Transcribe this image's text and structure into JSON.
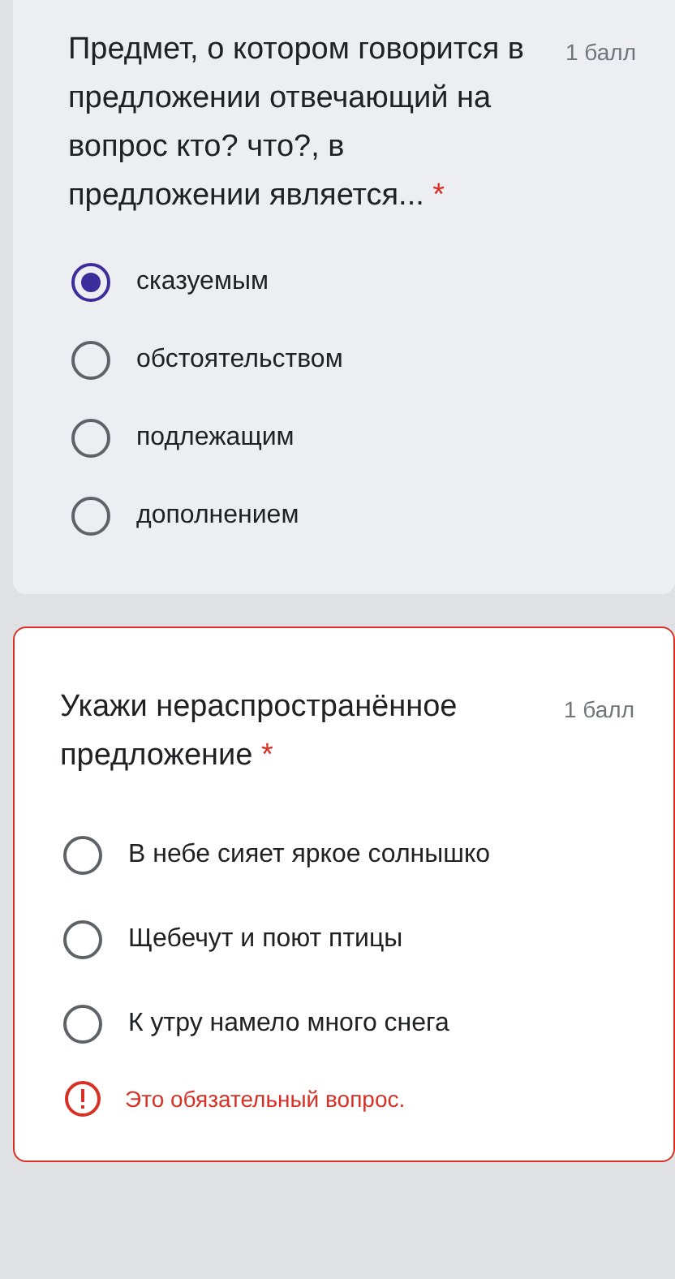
{
  "questions": [
    {
      "title": "Предмет, о котором говорится в предложении отвечающий на вопрос кто? что?, в предложении является...",
      "required_mark": "*",
      "points": "1 балл",
      "error": false,
      "options": [
        {
          "label": "сказуемым",
          "selected": true
        },
        {
          "label": "обстоятельством",
          "selected": false
        },
        {
          "label": "подлежащим",
          "selected": false
        },
        {
          "label": "дополнением",
          "selected": false
        }
      ]
    },
    {
      "title": "Укажи нераспространённое предложение",
      "required_mark": "*",
      "points": "1 балл",
      "error": true,
      "error_text": "Это обязательный вопрос.",
      "options": [
        {
          "label": "В небе сияет яркое солнышко",
          "selected": false
        },
        {
          "label": "Щебечут и поют птицы",
          "selected": false
        },
        {
          "label": "К утру намело много снега",
          "selected": false
        }
      ]
    }
  ]
}
